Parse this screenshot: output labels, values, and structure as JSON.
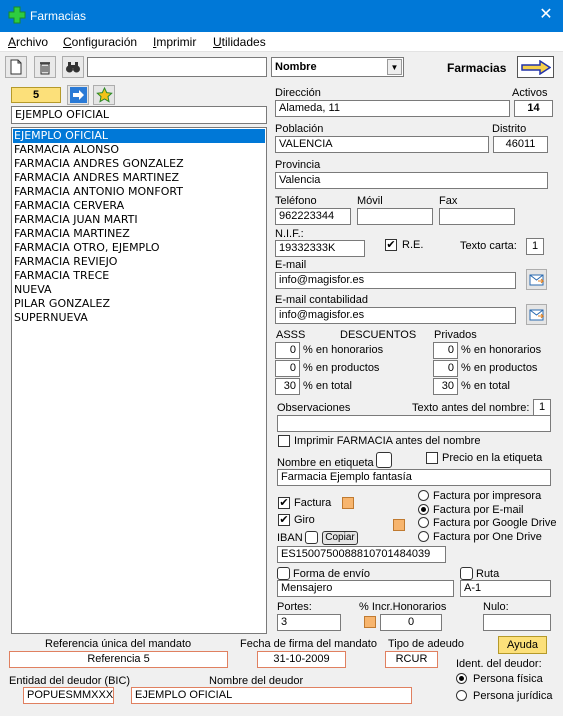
{
  "window": {
    "title": "Farmacias"
  },
  "menu": [
    "Archivo",
    "Configuración",
    "Imprimir",
    "Utilidades"
  ],
  "toolbar": {
    "search_value": "",
    "sort_select": "Nombre",
    "section_label": "Farmacias"
  },
  "left": {
    "counter": "5",
    "current_name": "EJEMPLO OFICIAL",
    "items": [
      "EJEMPLO OFICIAL",
      "FARMACIA ALONSO",
      "FARMACIA ANDRES GONZALEZ",
      "FARMACIA ANDRES MARTINEZ",
      "FARMACIA ANTONIO MONFORT",
      "FARMACIA CERVERA",
      "FARMACIA JUAN MARTI",
      "FARMACIA MARTINEZ",
      "FARMACIA OTRO, EJEMPLO",
      "FARMACIA REVIEJO",
      "FARMACIA TRECE",
      "NUEVA",
      "PILAR GONZALEZ",
      "SUPERNUEVA"
    ]
  },
  "form": {
    "direccion_label": "Dirección",
    "direccion": "Alameda, 11",
    "activos_label": "Activos",
    "activos": "14",
    "poblacion_label": "Población",
    "poblacion": "VALENCIA",
    "distrito_label": "Distrito",
    "distrito": "46011",
    "provincia_label": "Provincia",
    "provincia": "Valencia",
    "telefono_label": "Teléfono",
    "telefono": "962223344",
    "movil_label": "Móvil",
    "movil": "",
    "fax_label": "Fax",
    "fax": "",
    "nif_label": "N.I.F.:",
    "nif": "19332333K",
    "re_label": "R.E.",
    "re_checked": "✔",
    "texto_carta_label": "Texto carta:",
    "texto_carta": "1",
    "email_label": "E-mail",
    "email": "info@magisfor.es",
    "email_cont_label": "E-mail contabilidad",
    "email_cont": "info@magisfor.es",
    "asss_label": "ASSS",
    "descuentos_label": "DESCUENTOS",
    "privados_label": "Privados",
    "asss_honorarios": "0",
    "asss_productos": "0",
    "asss_total": "30",
    "priv_honorarios": "0",
    "priv_productos": "0",
    "priv_total": "30",
    "pct_honorarios": "% en honorarios",
    "pct_productos": "% en productos",
    "pct_total": "% en total",
    "observaciones_label": "Observaciones",
    "observaciones": "",
    "texto_antes_label": "Texto antes del nombre:",
    "texto_antes": "1",
    "imprimir_farmacia_label": "Imprimir FARMACIA antes del nombre",
    "nombre_etiqueta_label": "Nombre en etiqueta",
    "precio_etiqueta_label": "Precio en la etiqueta",
    "nombre_etiqueta": "Farmacia Ejemplo fantasía",
    "factura_label": "Factura",
    "giro_label": "Giro",
    "check_mark": "✔",
    "factura_impresora": "Factura por impresora",
    "factura_email": "Factura por E-mail",
    "factura_google": "Factura por Google Drive",
    "factura_onedrive": "Factura por One Drive",
    "iban_label": "IBAN",
    "copiar_label": "Copiar",
    "iban": "ES1500750088810701484039",
    "forma_envio_label": "Forma de envío",
    "forma_envio": "Mensajero",
    "ruta_label": "Ruta",
    "ruta": "A-1",
    "portes_label": "Portes:",
    "portes": "3",
    "incr_label": "% Incr.Honorarios",
    "incr": "0",
    "nulo_label": "Nulo:",
    "nulo": ""
  },
  "footer": {
    "referencia_label": "Referencia única del mandato",
    "referencia": "Referencia 5",
    "fecha_label": "Fecha de firma del mandato",
    "fecha": "31-10-2009",
    "tipo_label": "Tipo de adeudo",
    "tipo": "RCUR",
    "ayuda_label": "Ayuda",
    "bic_label": "Entidad del deudor (BIC)",
    "bic": "POPUESMMXXX",
    "nombre_deudor_label": "Nombre del deudor",
    "nombre_deudor": "EJEMPLO OFICIAL",
    "ident_label": "Ident. del deudor:",
    "persona_fisica": "Persona física",
    "persona_juridica": "Persona jurídica"
  }
}
